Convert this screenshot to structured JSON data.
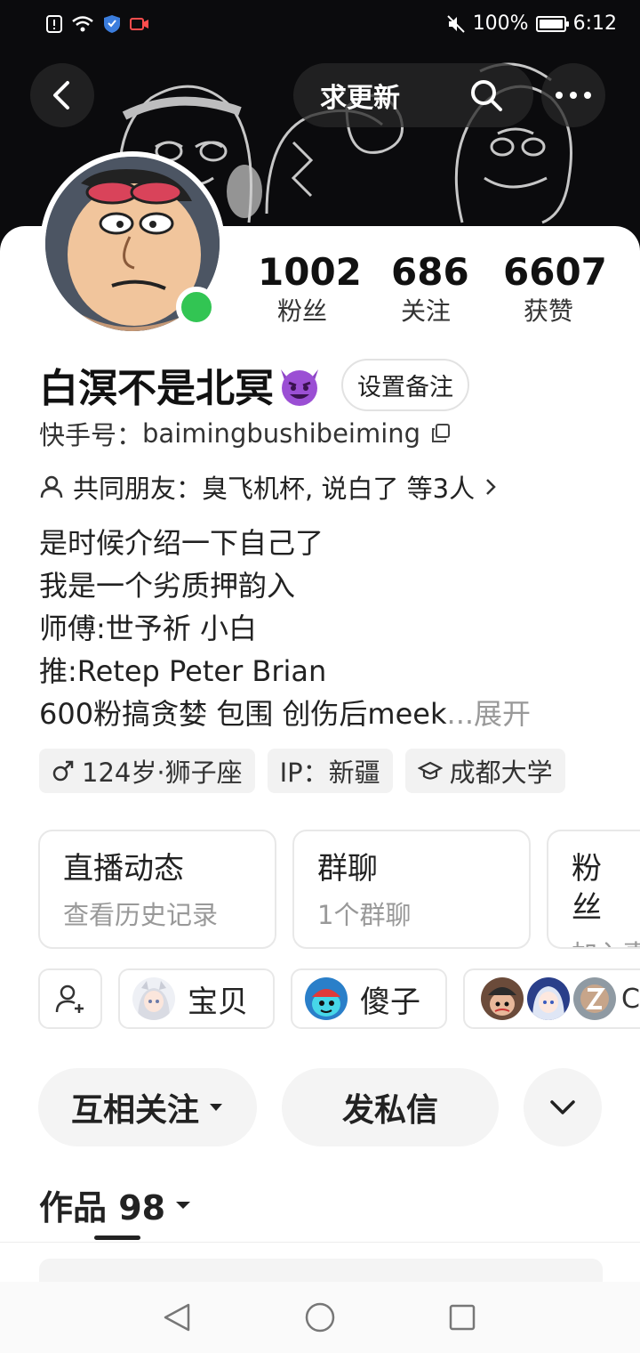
{
  "status_bar": {
    "battery": "100%",
    "time": "6:12",
    "battery_level": 1.0
  },
  "header": {
    "update_label": "求更新"
  },
  "profile": {
    "name": "白溟不是北冥",
    "remark_button": "设置备注",
    "id_label": "快手号：",
    "id_value": "baimingbushibeiming",
    "mutual_prefix": "共同朋友：",
    "mutual_names": "臭飞机杯, 说白了 等3人",
    "stats": [
      {
        "value": "1002",
        "label": "粉丝"
      },
      {
        "value": "686",
        "label": "关注"
      },
      {
        "value": "6607",
        "label": "获赞"
      }
    ],
    "bio": [
      "是时候介绍一下自己了",
      "我是一个劣质押韵入",
      "师傅:世予祈 小白",
      "推:Retep Peter Brian",
      "600粉搞贪婪 包围 创伤后meek"
    ],
    "bio_ellipsis": "...",
    "bio_expand": "展开",
    "tags": [
      "124岁·狮子座",
      "IP：新疆",
      "成都大学"
    ]
  },
  "features": [
    {
      "title": "直播动态",
      "subtitle": "查看历史记录"
    },
    {
      "title": "群聊",
      "subtitle": "1个群聊"
    },
    {
      "title": "粉丝",
      "subtitle": "加入事"
    }
  ],
  "groups": [
    {
      "name": "宝贝"
    },
    {
      "name": "傻子"
    }
  ],
  "group_more_letter": "C",
  "actions": {
    "follow": "互相关注",
    "message": "发私信"
  },
  "works": {
    "label": "作品 98"
  }
}
